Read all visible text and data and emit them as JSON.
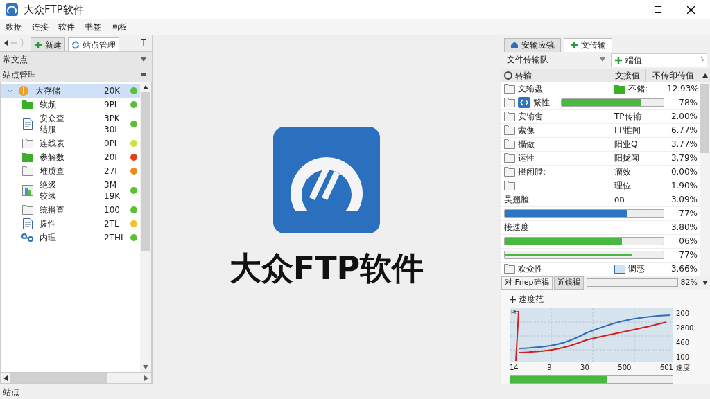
{
  "window": {
    "title": "大众FTP软件"
  },
  "menu": [
    "数据",
    "连接",
    "软件",
    "书签",
    "画板"
  ],
  "left_tabs": [
    {
      "label": "新建",
      "kind": "plus",
      "selected": false
    },
    {
      "label": "站点管理",
      "kind": "sync",
      "selected": true
    }
  ],
  "left_headers": [
    "常文点",
    "站点管理"
  ],
  "tree": [
    {
      "name": "大存储",
      "size": "20K",
      "color": "#5cbf3a",
      "kind": "orb",
      "selected": true,
      "expanded": true,
      "children": [
        {
          "name": "软频",
          "size": "9PL",
          "color": "#5cbf3a",
          "kind": "folder",
          "selected": false
        },
        {
          "name": "安众查结服",
          "size": "3PK\n30I",
          "color": "#5cbf3a",
          "kind": "doc",
          "selected": false
        },
        {
          "name": "连线表",
          "size": "0PI",
          "color": "#cce23a",
          "kind": "file",
          "selected": false
        },
        {
          "name": "参解数",
          "size": "20I",
          "color": "#e0401c",
          "kind": "folder",
          "selected": false
        },
        {
          "name": "堆质查",
          "size": "27I",
          "color": "#f08a1c",
          "kind": "file",
          "selected": false
        },
        {
          "name": "绝级较续",
          "size": "3M\n19K",
          "color": "#5cbf3a",
          "kind": "image",
          "selected": false
        },
        {
          "name": "统播查",
          "size": "100",
          "color": "#5cbf3a",
          "kind": "file",
          "selected": false
        },
        {
          "name": "拨性",
          "size": "2TL",
          "color": "#f0c030",
          "kind": "doc",
          "selected": false
        },
        {
          "name": "内理",
          "size": "2THI",
          "color": "#5cbf3a",
          "kind": "network",
          "selected": false
        }
      ]
    }
  ],
  "app_title": "大众FTP软件",
  "right_tabs": [
    {
      "label": "安输应镜",
      "kind": "home",
      "selected": false
    },
    {
      "label": "文传输",
      "kind": "plus",
      "selected": true
    }
  ],
  "queue_dropdown": "文件传输队",
  "add_button": "端值",
  "columns": [
    "转输",
    "文接值",
    "不传印传值"
  ],
  "rows": [
    {
      "kind": "file",
      "name": "文输盘",
      "col2": "不储:",
      "value": "12.93%"
    },
    {
      "kind": "progress",
      "name": "繁性",
      "level": 0.78,
      "value": "78%",
      "badge": true
    },
    {
      "kind": "file",
      "name": "安输舍",
      "col2": "TP传输",
      "value": "2.00%"
    },
    {
      "kind": "file",
      "name": "索像",
      "col2": "FP推闻",
      "value": "6.77%"
    },
    {
      "kind": "file",
      "name": "攝做",
      "col2": "阳业Q",
      "value": "3.77%"
    },
    {
      "kind": "file",
      "name": "运性",
      "col2": "阳拢闻",
      "value": "3.79%"
    },
    {
      "kind": "file",
      "name": "摂闲膛:",
      "col2": "瘤效",
      "value": "0.00%"
    },
    {
      "kind": "file",
      "col2": "理位",
      "value": "1.90%"
    },
    {
      "kind": "label",
      "name": "吴翘脸",
      "col2": "on",
      "value": "3.09%"
    },
    {
      "kind": "bar",
      "color": "#2f74c0",
      "level": 0.77,
      "value": "77%"
    },
    {
      "kind": "label",
      "name": "接速度",
      "value": "3.80%"
    },
    {
      "kind": "bar",
      "color": "#48b840",
      "level": 0.74,
      "value": "06%"
    },
    {
      "kind": "arrow",
      "level": 0.8,
      "value": "77%"
    },
    {
      "kind": "file",
      "name": "欢众性",
      "col2": "调惑",
      "value": "3.66%"
    }
  ],
  "bottom_tabs": [
    {
      "label": "对 Fnep碎褐",
      "selected": true
    },
    {
      "label": "近镜褐",
      "selected": false
    }
  ],
  "bottom_progress": {
    "level": 0,
    "value": "82%"
  },
  "speed": {
    "title": "速度范",
    "corner": "Pfc",
    "x_labels": [
      "14",
      "9",
      "30",
      "500",
      "601"
    ],
    "y_labels": [
      "200",
      "2800",
      "460",
      "100"
    ],
    "axis_label": "速度",
    "level": 0.6
  },
  "status_bar": "站点"
}
